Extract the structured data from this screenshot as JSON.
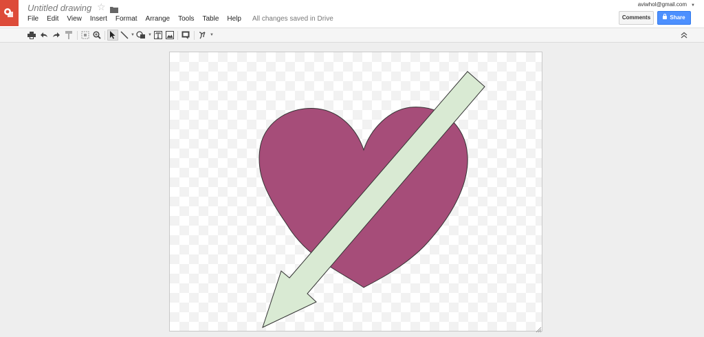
{
  "document": {
    "title": "Untitled drawing",
    "save_status": "All changes saved in Drive"
  },
  "menu": [
    {
      "label": "File"
    },
    {
      "label": "Edit"
    },
    {
      "label": "View"
    },
    {
      "label": "Insert"
    },
    {
      "label": "Format"
    },
    {
      "label": "Arrange"
    },
    {
      "label": "Tools"
    },
    {
      "label": "Table"
    },
    {
      "label": "Help"
    }
  ],
  "account": {
    "email": "aviwhol@gmail.com"
  },
  "buttons": {
    "comments_label": "Comments",
    "share_label": "Share"
  },
  "toolbar": {
    "tools": [
      "print-icon",
      "undo-icon",
      "redo-icon",
      "paint-format-icon",
      "select-all-icon",
      "zoom-icon",
      "select-pointer-icon",
      "line-icon",
      "shape-icon",
      "text-box-icon",
      "image-icon",
      "comment-icon",
      "format-options-icon",
      "collapse-toolbar-icon"
    ]
  },
  "colors": {
    "brand": "#dd4b39",
    "share_button": "#4d90fe",
    "heart_fill": "#a64d79",
    "arrow_fill": "#d9ead3",
    "shape_stroke": "#333333"
  },
  "drawing": {
    "shapes": [
      "heart",
      "arrow"
    ]
  }
}
